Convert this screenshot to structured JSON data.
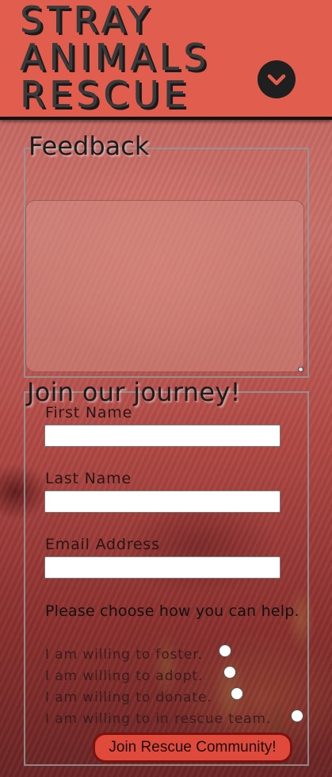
{
  "header": {
    "logo_lines": [
      "STRAY",
      "ANIMALS",
      "RESCUE"
    ],
    "menu_icon": "chevron-down-icon"
  },
  "feedback": {
    "legend": "Feedback",
    "textarea_value": ""
  },
  "join": {
    "legend": "Join our journey!",
    "fields": [
      {
        "label": "First Name",
        "value": ""
      },
      {
        "label": "Last Name",
        "value": ""
      },
      {
        "label": "Email Address",
        "value": ""
      }
    ],
    "help_prompt": "Please choose how you can help.",
    "options": [
      {
        "label": "I am willing to foster.",
        "checked": false
      },
      {
        "label": "I am willing to adopt.",
        "checked": false
      },
      {
        "label": "I am willing to donate.",
        "checked": false
      },
      {
        "label": "I am willing to in rescue team.",
        "checked": false
      }
    ],
    "submit_label": "Join Rescue Community!"
  },
  "colors": {
    "header_bg": "#e15d4e",
    "button_bg": "#e04a3a",
    "button_border": "#7a1210"
  }
}
